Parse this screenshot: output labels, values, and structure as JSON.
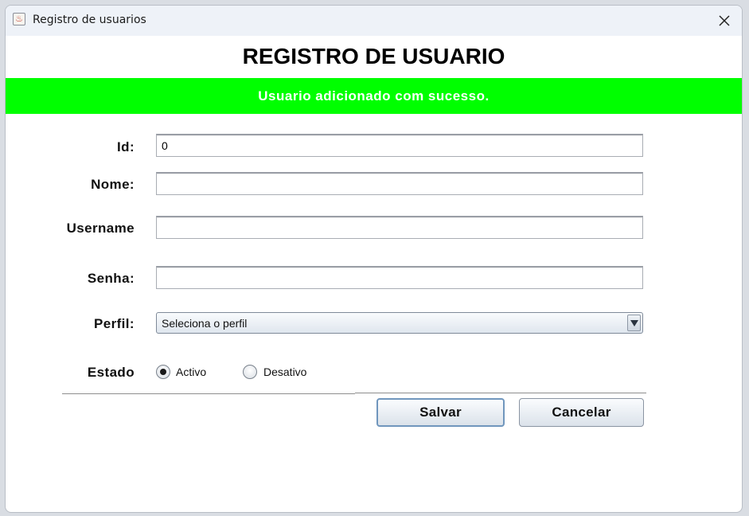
{
  "window": {
    "title": "Registro de usuarios",
    "app_icon": "java-icon",
    "close_icon": "close-icon"
  },
  "form": {
    "heading": "REGISTRO DE USUARIO",
    "status_message": "Usuario adicionado com sucesso.",
    "status_color": "#00ff00",
    "id_label": "Id:",
    "id_value": "0",
    "nome_label": "Nome:",
    "nome_value": "",
    "username_label": "Username",
    "username_value": "",
    "senha_label": "Senha:",
    "senha_value": "",
    "perfil_label": "Perfil:",
    "perfil_selected": "Seleciona o perfil",
    "estado_label": "Estado",
    "estado_options": [
      {
        "label": "Activo",
        "checked": true
      },
      {
        "label": "Desativo",
        "checked": false
      }
    ]
  },
  "actions": {
    "save_label": "Salvar",
    "cancel_label": "Cancelar"
  }
}
